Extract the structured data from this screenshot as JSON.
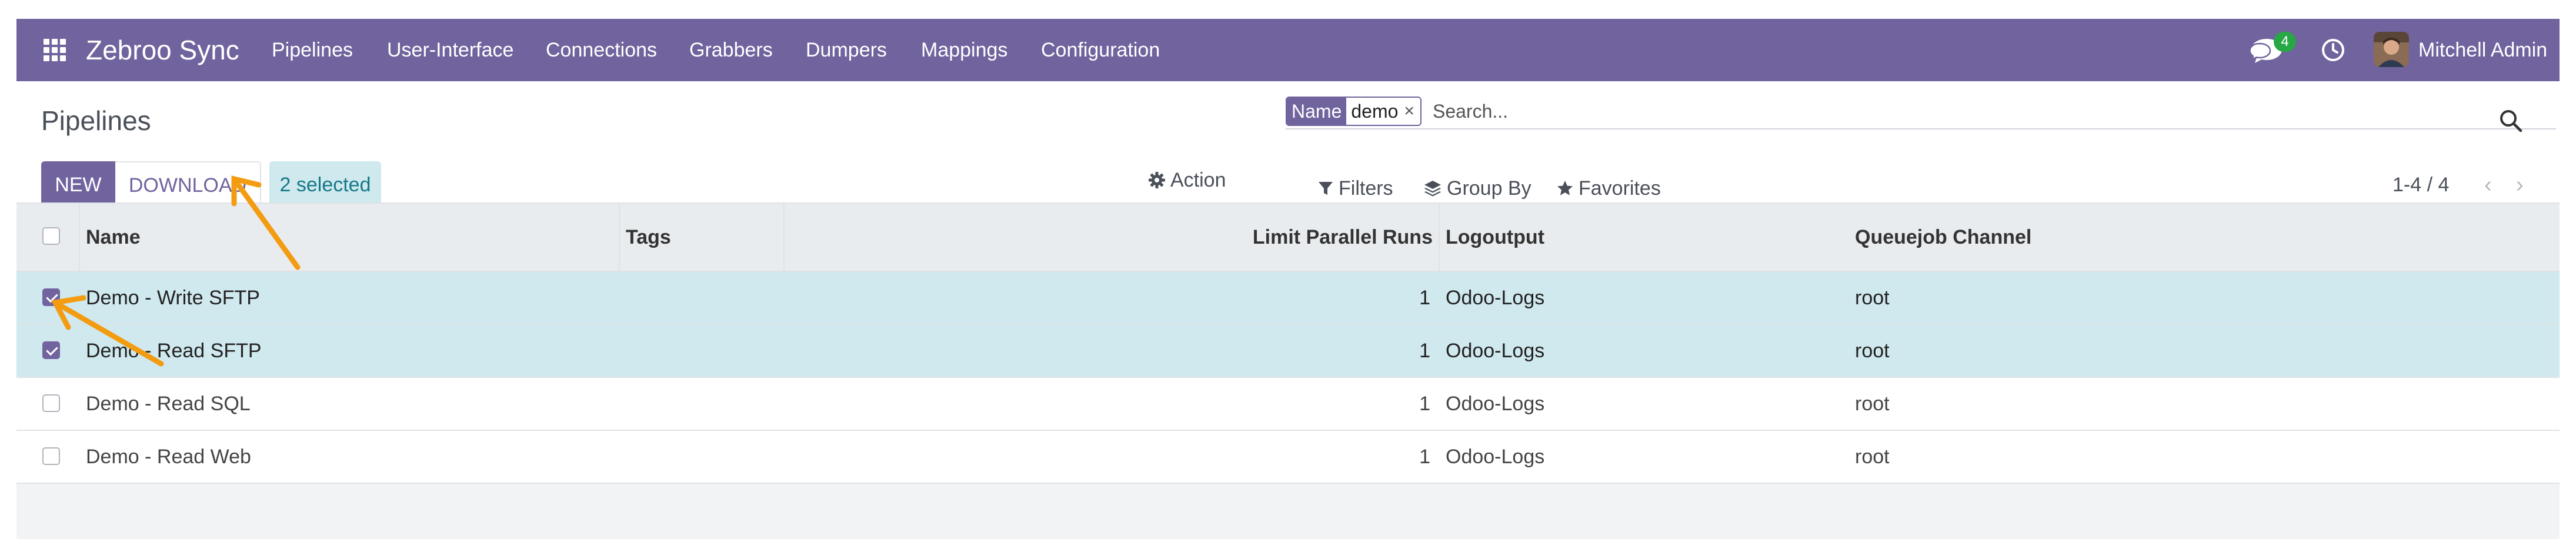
{
  "navbar": {
    "brand": "Zebroo Sync",
    "menu": [
      "Pipelines",
      "User-Interface",
      "Connections",
      "Grabbers",
      "Dumpers",
      "Mappings",
      "Configuration"
    ],
    "chat_badge_count": "4",
    "user_name": "Mitchell Admin",
    "icons": [
      "apps-grid-icon",
      "chat-icon",
      "clock-icon",
      "user-avatar"
    ]
  },
  "control_panel": {
    "title": "Pipelines",
    "new_label": "NEW",
    "download_label": "DOWNLOAD",
    "selected_label": "2 selected",
    "action_label": "Action",
    "filters_label": "Filters",
    "group_by_label": "Group By",
    "favorites_label": "Favorites",
    "pager": "1-4 / 4",
    "search": {
      "facet_label": "Name",
      "facet_value": "demo",
      "facet_remove": "×",
      "placeholder": "Search..."
    }
  },
  "table": {
    "columns": [
      "Name",
      "Tags",
      "Limit Parallel Runs",
      "Logoutput",
      "Queuejob Channel"
    ],
    "rows": [
      {
        "name": "Demo - Write SFTP",
        "tags": "",
        "limit": "1",
        "logoutput": "Odoo-Logs",
        "channel": "root",
        "selected": true
      },
      {
        "name": "Demo - Read SFTP",
        "tags": "",
        "limit": "1",
        "logoutput": "Odoo-Logs",
        "channel": "root",
        "selected": true
      },
      {
        "name": "Demo - Read SQL",
        "tags": "",
        "limit": "1",
        "logoutput": "Odoo-Logs",
        "channel": "root",
        "selected": false
      },
      {
        "name": "Demo - Read Web",
        "tags": "",
        "limit": "1",
        "logoutput": "Odoo-Logs",
        "channel": "root",
        "selected": false
      }
    ]
  },
  "colors": {
    "primary": "#71639e",
    "selected_row": "#d0e9ee",
    "selected_badge_bg": "#cfe9ee",
    "selected_badge_text": "#167989",
    "chat_badge": "#28a745",
    "annotation_arrow": "#f39c12"
  }
}
